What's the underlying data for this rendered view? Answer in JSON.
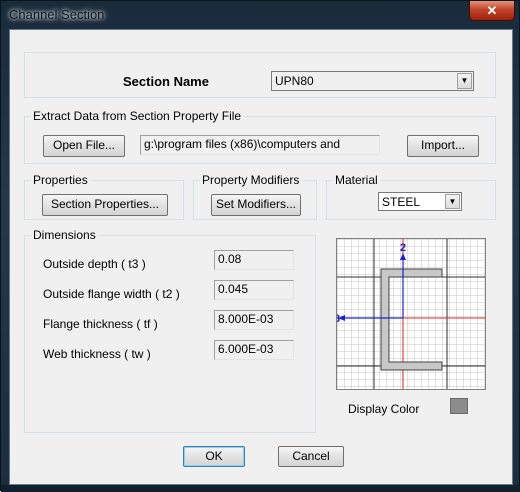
{
  "window": {
    "title": "Channel Section",
    "close_glyph": "✕"
  },
  "section_name": {
    "label": "Section Name",
    "value": "UPN80"
  },
  "extract": {
    "title": "Extract Data from Section Property File",
    "open_button": "Open File...",
    "path": "g:\\program files (x86)\\computers and",
    "import_button": "Import..."
  },
  "properties": {
    "title": "Properties",
    "button": "Section Properties..."
  },
  "modifiers": {
    "title": "Property Modifiers",
    "button": "Set Modifiers..."
  },
  "material": {
    "title": "Material",
    "value": "STEEL"
  },
  "dimensions": {
    "title": "Dimensions",
    "rows": [
      {
        "label": "Outside depth  ( t3 )",
        "value": "0.08"
      },
      {
        "label": "Outside flange width  ( t2 )",
        "value": "0.045"
      },
      {
        "label": "Flange thickness  ( tf )",
        "value": "8.000E-03"
      },
      {
        "label": "Web thickness  ( tw )",
        "value": "6.000E-03"
      }
    ]
  },
  "preview": {
    "axis2_label": "2",
    "axis3_label": "3",
    "section_color": "#c8c8c8",
    "axis_color": "#2020d0",
    "centroid_line_color": "#e02020"
  },
  "display_color": {
    "label": "Display Color",
    "color": "#8c8c8c"
  },
  "footer": {
    "ok": "OK",
    "cancel": "Cancel"
  }
}
